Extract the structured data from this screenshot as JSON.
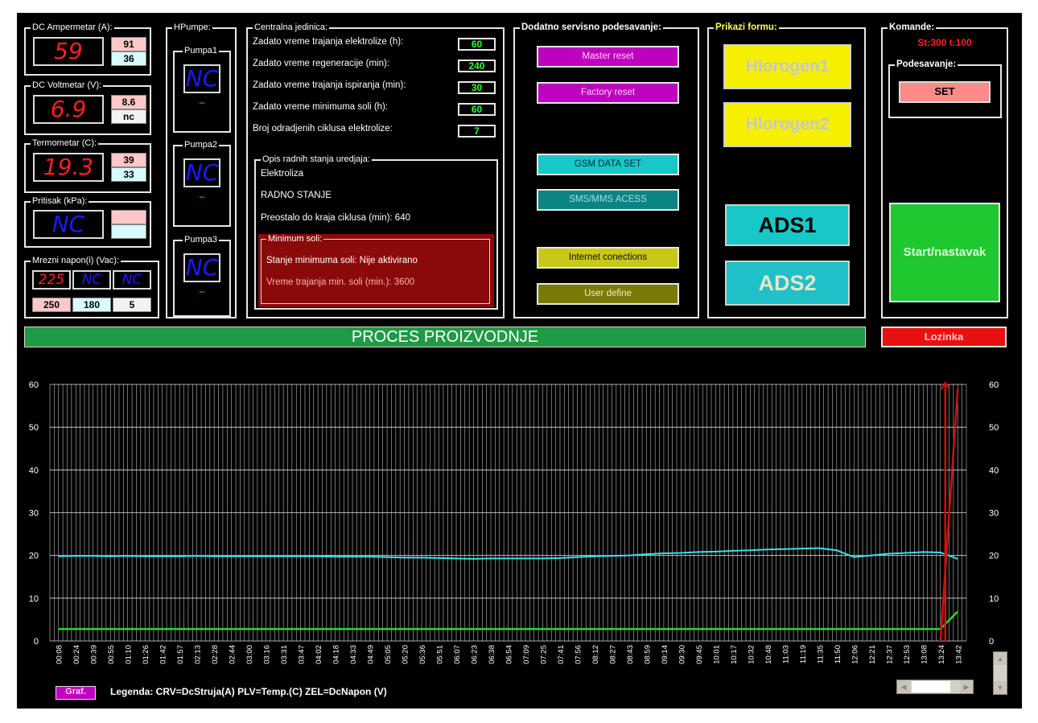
{
  "dc_ampermetar": {
    "title": "DC Ampermetar (A):",
    "value": "59",
    "max": "91",
    "min": "36"
  },
  "dc_voltmetar": {
    "title": "DC Voltmetar (V):",
    "value": "6.9",
    "max": "8.6",
    "min": "nc"
  },
  "termometar": {
    "title": "Termometar (C):",
    "value": "19.3",
    "max": "39",
    "min": "33"
  },
  "pritisak": {
    "title": "Pritisak (kPa):",
    "value": "NC",
    "max": "",
    "min": ""
  },
  "mrezni_napon": {
    "title": "Mrezni napon(i) (Vac):",
    "values": [
      "225",
      "NC",
      "NC"
    ],
    "limits": [
      "250",
      "180",
      "5"
    ]
  },
  "hpumpe": {
    "title": "HPumpe:",
    "pumps": [
      {
        "name": "Pumpa1",
        "value": "NC",
        "status": "–"
      },
      {
        "name": "Pumpa2",
        "value": "NC",
        "status": "–"
      },
      {
        "name": "Pumpa3",
        "value": "NC",
        "status": "–"
      }
    ]
  },
  "centralna": {
    "title": "Centralna jedinica:",
    "rows": [
      {
        "label": "Zadato vreme trajanja  elektrolize (h):",
        "value": "60"
      },
      {
        "label": "Zadato vreme  regeneracije (min):",
        "value": "240"
      },
      {
        "label": "Zadato vreme trajanja ispiranja (min):",
        "value": "30"
      },
      {
        "label": "Zadato vreme minimuma soli (h):",
        "value": "60"
      },
      {
        "label": "Broj odradjenih ciklusa elektrolize:",
        "value": "7"
      }
    ],
    "opis_title": "Opis radnih stanja uredjaja:",
    "opis_lines": [
      "Elektroliza",
      "RADNO STANJE",
      "Preostalo do kraja ciklusa (min): 640"
    ],
    "min_soli_title": "Minimum soli:",
    "min_soli_status": "Stanje minimuma soli: Nije aktivirano",
    "min_soli_time": "Vreme trajanja min. soli (min.):  3600"
  },
  "dodatno": {
    "title": "Dodatno servisno podesavanje:",
    "buttons": [
      "Master reset",
      "Factory reset",
      "GSM DATA SET",
      "SMS/MMS ACESS",
      "Internet conections",
      "User define"
    ]
  },
  "prikazi": {
    "title": "Prikazi formu:",
    "buttons": [
      "Hlorogen1",
      "Hlorogen2",
      "ADS1",
      "ADS2"
    ]
  },
  "komande": {
    "title": "Komande:",
    "status": "St:300 t:100",
    "podesavanje_title": "Podesavanje:",
    "set_label": "SET",
    "start_label": "Start/nastavak"
  },
  "banner": {
    "label": "PROCES PROIZVODNJE"
  },
  "lozinka": {
    "label": "Lozinka"
  },
  "graf_button": {
    "label": "Graf."
  },
  "legend": {
    "text": "Legenda: CRV=DcStruja(A)  PLV=Temp.(C)  ZEL=DcNapon (V)"
  },
  "colors": {
    "blue_series": "#38e0e8",
    "green_series": "#22dd22",
    "red_series": "#cc1111",
    "grid": "#ffffff",
    "banner": "#1f9a45",
    "lozinka": "#e81010"
  },
  "chart_data": {
    "type": "line",
    "ylim": [
      0,
      60
    ],
    "yticks": [
      0,
      10,
      20,
      30,
      40,
      50,
      60
    ],
    "grid": true,
    "x": [
      "00:08",
      "00:24",
      "00:39",
      "00:55",
      "01:10",
      "01:26",
      "01:42",
      "01:57",
      "02:13",
      "02:28",
      "02:44",
      "03:00",
      "03:16",
      "03:31",
      "03:47",
      "04:02",
      "04:18",
      "04:33",
      "04:49",
      "05:05",
      "05:20",
      "05:36",
      "05:51",
      "06:07",
      "06:23",
      "06:38",
      "06:54",
      "07:09",
      "07:25",
      "07:41",
      "07:56",
      "08:12",
      "08:27",
      "08:43",
      "08:59",
      "09:14",
      "09:30",
      "09:45",
      "10:01",
      "10:17",
      "10:32",
      "10:48",
      "11:03",
      "11:19",
      "11:35",
      "11:50",
      "12:06",
      "12:21",
      "12:37",
      "12:53",
      "13:08",
      "13:24",
      "13:42"
    ],
    "series": [
      {
        "name": "PLV=Temp.(C)",
        "color": "#38e0e8",
        "values": [
          19.8,
          19.9,
          19.9,
          19.8,
          19.9,
          19.8,
          19.8,
          19.8,
          19.9,
          19.8,
          19.8,
          19.8,
          19.8,
          19.8,
          19.8,
          19.8,
          19.7,
          19.7,
          19.7,
          19.6,
          19.5,
          19.5,
          19.4,
          19.3,
          19.2,
          19.3,
          19.3,
          19.3,
          19.3,
          19.4,
          19.6,
          19.8,
          19.9,
          20.0,
          20.3,
          20.5,
          20.6,
          20.8,
          20.9,
          21.1,
          21.2,
          21.4,
          21.5,
          21.6,
          21.7,
          21.2,
          19.6,
          20.0,
          20.4,
          20.6,
          20.8,
          20.7,
          19.2
        ]
      },
      {
        "name": "ZEL=DcNapon (V)",
        "color": "#22dd22",
        "values": [
          2.8,
          2.8,
          2.8,
          2.8,
          2.8,
          2.8,
          2.8,
          2.8,
          2.8,
          2.8,
          2.8,
          2.8,
          2.8,
          2.8,
          2.8,
          2.8,
          2.8,
          2.8,
          2.8,
          2.8,
          2.8,
          2.8,
          2.8,
          2.8,
          2.8,
          2.8,
          2.8,
          2.8,
          2.8,
          2.8,
          2.8,
          2.8,
          2.8,
          2.8,
          2.8,
          2.8,
          2.8,
          2.8,
          2.8,
          2.8,
          2.8,
          2.8,
          2.8,
          2.8,
          2.8,
          2.8,
          2.8,
          2.8,
          2.8,
          2.8,
          2.8,
          2.8,
          6.9
        ]
      },
      {
        "name": "CRV=DcStruja(A)",
        "color": "#cc1111",
        "values": [
          null,
          null,
          null,
          null,
          null,
          null,
          null,
          null,
          null,
          null,
          null,
          null,
          null,
          null,
          null,
          null,
          null,
          null,
          null,
          null,
          null,
          null,
          null,
          null,
          null,
          null,
          null,
          null,
          null,
          null,
          null,
          null,
          null,
          null,
          null,
          null,
          null,
          null,
          null,
          null,
          null,
          null,
          null,
          null,
          null,
          null,
          null,
          null,
          null,
          null,
          null,
          0,
          59
        ]
      }
    ]
  }
}
